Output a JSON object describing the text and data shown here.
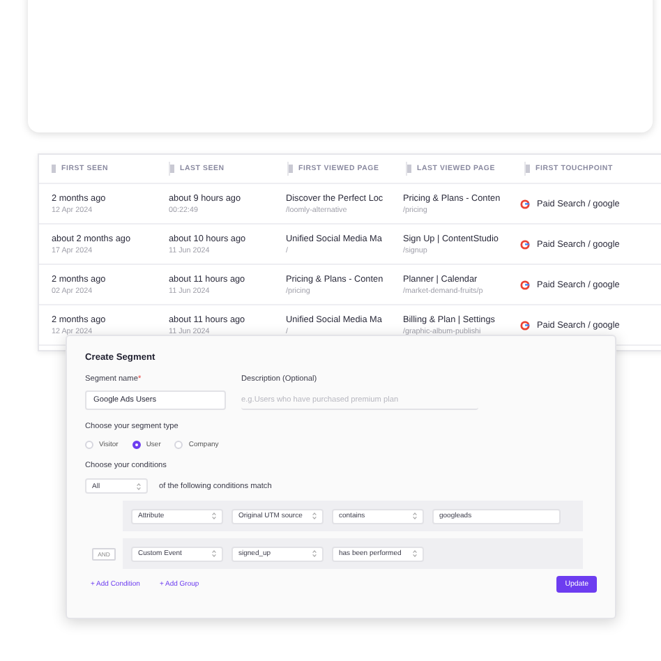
{
  "table": {
    "columns": [
      "FIRST SEEN",
      "LAST SEEN",
      "FIRST VIEWED PAGE",
      "LAST VIEWED PAGE",
      "FIRST TOUCHPOINT"
    ],
    "rows": [
      {
        "first_seen": [
          "2 months ago",
          "12 Apr 2024"
        ],
        "last_seen": [
          "about 9 hours ago",
          "00:22:49"
        ],
        "first_viewed": [
          "Discover the Perfect Loc",
          "/loomly-alternative"
        ],
        "last_viewed": [
          "Pricing & Plans - Conten",
          "/pricing"
        ],
        "touchpoint": "Paid Search / google"
      },
      {
        "first_seen": [
          "about 2 months ago",
          "17 Apr 2024"
        ],
        "last_seen": [
          "about 10 hours ago",
          "11 Jun 2024"
        ],
        "first_viewed": [
          "Unified Social Media Ma",
          "/"
        ],
        "last_viewed": [
          "Sign Up | ContentStudio",
          "/signup"
        ],
        "touchpoint": "Paid Search / google"
      },
      {
        "first_seen": [
          "2 months ago",
          "02 Apr 2024"
        ],
        "last_seen": [
          "about 11 hours ago",
          "11 Jun 2024"
        ],
        "first_viewed": [
          "Pricing & Plans - Conten",
          "/pricing"
        ],
        "last_viewed": [
          "Planner | Calendar",
          "/market-demand-fruits/p"
        ],
        "touchpoint": "Paid Search / google"
      },
      {
        "first_seen": [
          "2 months ago",
          "12 Apr 2024"
        ],
        "last_seen": [
          "about 11 hours ago",
          "11 Jun 2024"
        ],
        "first_viewed": [
          "Unified Social Media Ma",
          "/"
        ],
        "last_viewed": [
          "Billing & Plan | Settings",
          "/graphic-album-publishi"
        ],
        "touchpoint": "Paid Search / google"
      }
    ]
  },
  "dialog": {
    "title": "Create Segment",
    "name_label": "Segment name",
    "required_mark": "*",
    "name_value": "Google Ads Users",
    "description_label": "Description (Optional)",
    "description_placeholder": "e.g.Users who have purchased premium plan",
    "type_label": "Choose your segment type",
    "types": [
      {
        "label": "Visitor",
        "selected": false
      },
      {
        "label": "User",
        "selected": true
      },
      {
        "label": "Company",
        "selected": false
      }
    ],
    "conditions_label": "Choose your conditions",
    "match_select": "All",
    "match_text": "of the following conditions match",
    "groups": [
      {
        "fields": [
          {
            "kind": "select",
            "value": "Attribute"
          },
          {
            "kind": "select",
            "value": "Original UTM source"
          },
          {
            "kind": "select",
            "value": "contains"
          },
          {
            "kind": "input",
            "value": "googleads"
          }
        ]
      },
      {
        "conjunction": "AND",
        "fields": [
          {
            "kind": "select",
            "value": "Custom Event"
          },
          {
            "kind": "select",
            "value": "signed_up"
          },
          {
            "kind": "select",
            "value": "has been performed"
          }
        ]
      }
    ],
    "add_condition": "+ Add Condition",
    "add_group": "+ Add Group",
    "update_button": "Update"
  }
}
